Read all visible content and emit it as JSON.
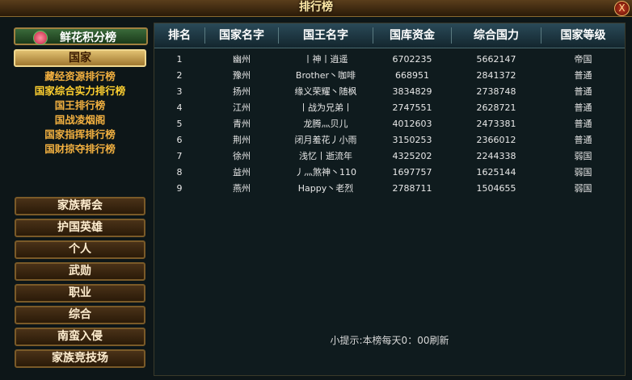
{
  "window": {
    "title": "排行榜",
    "close_label": "X"
  },
  "sidebar": {
    "flower_header": "鲜花积分榜",
    "nation_button": "国家",
    "sub_items": [
      "藏经资源排行榜",
      "国家综合实力排行榜",
      "国王排行榜",
      "国战凌烟阁",
      "国家指挥排行榜",
      "国财掠夺排行榜"
    ],
    "active_sub_item": "国家综合实力排行榜",
    "categories": [
      "家族帮会",
      "护国英雄",
      "个人",
      "武勋",
      "职业",
      "综合",
      "南蛮入侵",
      "家族竞技场"
    ]
  },
  "table": {
    "columns": [
      "排名",
      "国家名字",
      "国王名字",
      "国库资金",
      "综合国力",
      "国家等级"
    ],
    "rows": [
      [
        "1",
        "幽州",
        "丨神丨逍遥",
        "6702235",
        "5662147",
        "帝国"
      ],
      [
        "2",
        "豫州",
        "Brother丶咖啡",
        "668951",
        "2841372",
        "普通"
      ],
      [
        "3",
        "扬州",
        "缘义荣耀丶随枫",
        "3834829",
        "2738748",
        "普通"
      ],
      [
        "4",
        "江州",
        "丨战为兄弟丨",
        "2747551",
        "2628721",
        "普通"
      ],
      [
        "5",
        "青州",
        "龙腾灬贝儿",
        "4012603",
        "2473381",
        "普通"
      ],
      [
        "6",
        "荆州",
        "闭月羞花丿小雨",
        "3150253",
        "2366012",
        "普通"
      ],
      [
        "7",
        "徐州",
        "浅忆丨逝流年",
        "4325202",
        "2244338",
        "弱国"
      ],
      [
        "8",
        "益州",
        "丿灬煞神丶110",
        "1697757",
        "1625144",
        "弱国"
      ],
      [
        "9",
        "燕州",
        "Happy丶老烈",
        "2788711",
        "1504655",
        "弱国"
      ]
    ]
  },
  "tip": "小提示:本榜每天0：00刷新",
  "colors": {
    "gold": "#ffd030",
    "text": "#e8e8e8",
    "header_bg": "#2a4a58"
  }
}
